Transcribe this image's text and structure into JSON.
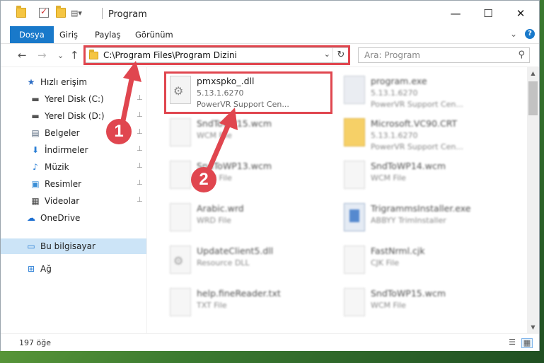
{
  "window": {
    "title": "Program",
    "controls": {
      "minimize": "—",
      "maximize": "☐",
      "close": "✕"
    }
  },
  "ribbon": {
    "tabs": [
      "Dosya",
      "Giriş",
      "Paylaş",
      "Görünüm"
    ],
    "active_tab": "Dosya",
    "collapse_glyph": "⌄",
    "help_glyph": "?"
  },
  "nav": {
    "back": "←",
    "forward": "→",
    "recent": "⌄",
    "up": "↑",
    "address": "C:\\Program Files\\Program Dizini",
    "address_dropdown": "⌄",
    "refresh": "↻",
    "search_placeholder": "Ara: Program",
    "search_glyph": "⚲"
  },
  "sidebar": {
    "items": [
      {
        "label": "Hızlı erişim",
        "icon": "star-icon",
        "glyph": "★",
        "color": "#2b6cc4",
        "pinned": false
      },
      {
        "label": "Yerel Disk (C:)",
        "icon": "drive-icon",
        "glyph": "▬",
        "color": "#555555",
        "pinned": true
      },
      {
        "label": "Yerel Disk (D:)",
        "icon": "drive-icon",
        "glyph": "▬",
        "color": "#555555",
        "pinned": true
      },
      {
        "label": "Belgeler",
        "icon": "documents-icon",
        "glyph": "▤",
        "color": "#5a6b80",
        "pinned": true
      },
      {
        "label": "İndirmeler",
        "icon": "download-icon",
        "glyph": "⬇",
        "color": "#2b7fd6",
        "pinned": true
      },
      {
        "label": "Müzik",
        "icon": "music-icon",
        "glyph": "♪",
        "color": "#2b7fd6",
        "pinned": true
      },
      {
        "label": "Resimler",
        "icon": "pictures-icon",
        "glyph": "▣",
        "color": "#3a8ed6",
        "pinned": true
      },
      {
        "label": "Videolar",
        "icon": "video-icon",
        "glyph": "▦",
        "color": "#444444",
        "pinned": true
      },
      {
        "label": "OneDrive",
        "icon": "cloud-icon",
        "glyph": "☁",
        "color": "#1d6fd1",
        "pinned": false
      },
      {
        "label": "Bu bilgisayar",
        "icon": "computer-icon",
        "glyph": "▭",
        "color": "#2b7fd6",
        "pinned": false
      },
      {
        "label": "Ağ",
        "icon": "network-icon",
        "glyph": "⊞",
        "color": "#2b7fd6",
        "pinned": false
      }
    ],
    "pin_glyph": "📌",
    "selected_index": 9
  },
  "files": [
    {
      "name": "pmxspko_.dll",
      "version": "5.13.1.6270",
      "desc": "PowerVR Support Cen...",
      "thumb": "gear",
      "blurred": false
    },
    {
      "name": "program.exe",
      "version": "5.13.1.6270",
      "desc": "PowerVR Support Cen...",
      "thumb": "exe",
      "blurred": true
    },
    {
      "name": "SndToWP15.wcm",
      "version": "WCM File",
      "desc": "",
      "thumb": "plain",
      "blurred": true
    },
    {
      "name": "Microsoft.VC90.CRT",
      "version": "5.13.1.6270",
      "desc": "PowerVR Support Cen...",
      "thumb": "folder",
      "blurred": true
    },
    {
      "name": "SndToWP13.wcm",
      "version": "WCM File",
      "desc": "",
      "thumb": "plain",
      "blurred": true
    },
    {
      "name": "SndToWP14.wcm",
      "version": "WCM File",
      "desc": "",
      "thumb": "plain",
      "blurred": true
    },
    {
      "name": "Arabic.wrd",
      "version": "WRD File",
      "desc": "",
      "thumb": "plain",
      "blurred": true
    },
    {
      "name": "TrigrammsInstaller.exe",
      "version": "ABBYY TrimInstaller",
      "desc": "",
      "thumb": "app",
      "blurred": true
    },
    {
      "name": "UpdateClient5.dll",
      "version": "Resource DLL",
      "desc": "",
      "thumb": "gear",
      "blurred": true
    },
    {
      "name": "FastNrml.cjk",
      "version": "CJK File",
      "desc": "",
      "thumb": "plain",
      "blurred": true
    },
    {
      "name": "help.fineReader.txt",
      "version": "TXT File",
      "desc": "",
      "thumb": "plain",
      "blurred": true
    },
    {
      "name": "SndToWP15.wcm",
      "version": "WCM File",
      "desc": "",
      "thumb": "plain",
      "blurred": true
    }
  ],
  "status": {
    "count": "197 öğe",
    "view_details": "☰",
    "view_tiles": "▦"
  },
  "annotations": {
    "step1": "1",
    "step2": "2",
    "color": "#e0464f"
  },
  "scroll": {
    "up": "▲",
    "down": "▼"
  }
}
